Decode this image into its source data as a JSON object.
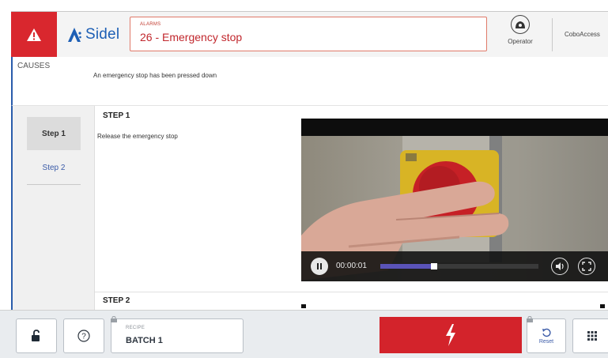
{
  "header": {
    "brand": "Sidel",
    "alarm_section_label": "ALARMS",
    "alarm_title": "26 - Emergency stop",
    "operator_label": "Operator",
    "user_name": "CoboAccess"
  },
  "causes": {
    "label": "CAUSES",
    "text": "An emergency stop has been pressed down"
  },
  "steps": {
    "tabs": [
      {
        "label": "Step 1",
        "active": true
      },
      {
        "label": "Step 2",
        "active": false
      }
    ],
    "step1_heading": "STEP 1",
    "step1_text": "Release the emergency stop",
    "step2_heading": "STEP 2"
  },
  "video": {
    "time": "00:00:01",
    "progress": 0.34,
    "state": "playing"
  },
  "footer": {
    "recipe_label": "RECIPE",
    "recipe_value": "BATCH 1",
    "reset_label": "Reset"
  },
  "colors": {
    "alarm_red": "#d9272e",
    "brand_blue": "#1d5fb5",
    "accent_blue": "#2a5cab",
    "progress": "#5a53b8"
  },
  "icons": [
    "warning-icon",
    "sidel-logo-icon",
    "operator-icon",
    "play-pause-icon",
    "volume-icon",
    "fullscreen-icon",
    "unlock-icon",
    "help-icon",
    "lock-icon",
    "lightning-icon",
    "reset-icon",
    "grid-icon"
  ]
}
